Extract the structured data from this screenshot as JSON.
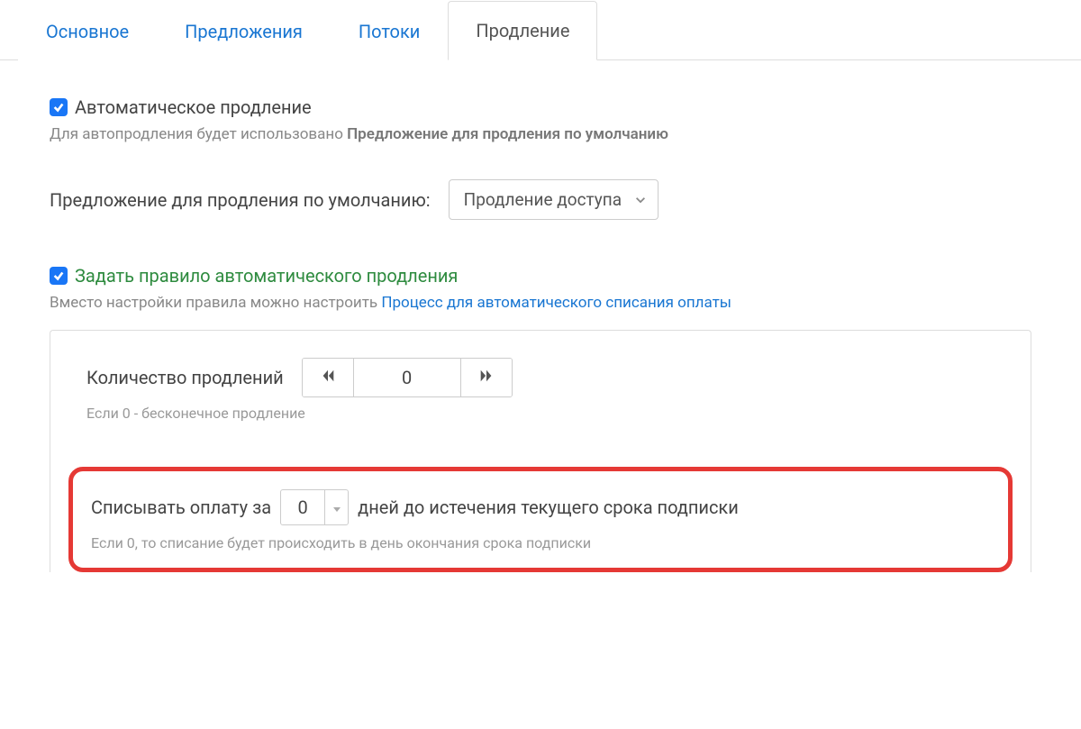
{
  "tabs": {
    "main": "Основное",
    "offers": "Предложения",
    "streams": "Потоки",
    "renewal": "Продление"
  },
  "auto_renew": {
    "label": "Автоматическое продление",
    "hint_prefix": "Для автопродления будет использовано ",
    "hint_bold": "Предложение для продления по умолчанию"
  },
  "default_offer": {
    "label": "Предложение для продления по умолчанию:",
    "value": "Продление доступа"
  },
  "rule": {
    "label": "Задать правило автоматического продления",
    "hint_prefix": "Вместо настройки правила можно настроить ",
    "hint_link": "Процесс для автоматического списания оплаты"
  },
  "count": {
    "label": "Количество продлений",
    "value": "0",
    "hint": "Если 0 - бесконечное продление"
  },
  "charge": {
    "prefix": "Списывать оплату за",
    "value": "0",
    "suffix": "дней до истечения текущего срока подписки",
    "hint": "Если 0, то списание будет происходить в день окончания срока подписки"
  }
}
